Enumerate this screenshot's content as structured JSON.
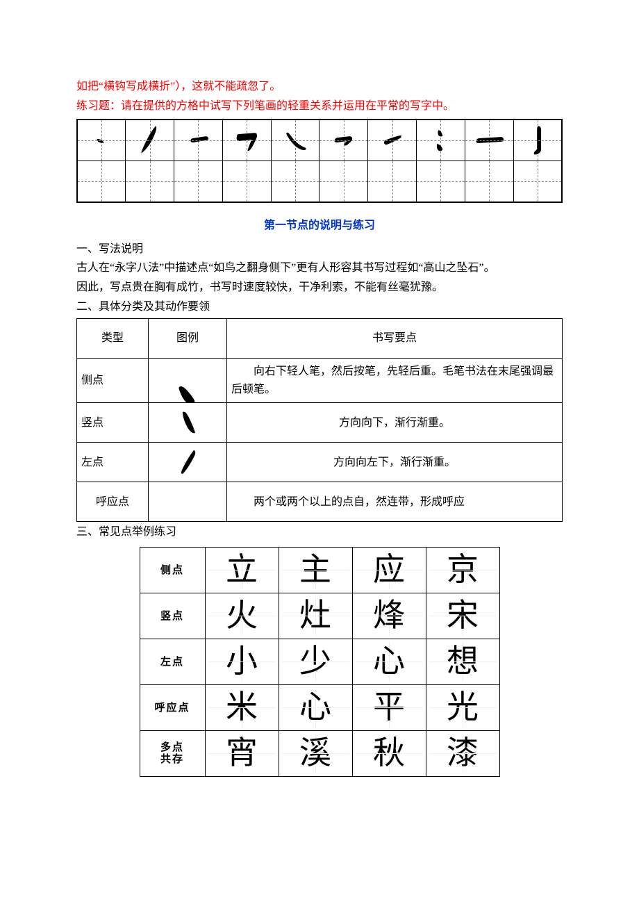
{
  "intro_lines": [
    "如把“横钩写成横折”），这就不能疏忽了。",
    "练习题：请在提供的方格中试写下列笔画的轻重关系并运用在平常的写字中。"
  ],
  "section_title": "第一节点的说明与练习",
  "heading_1": "一、写法说明",
  "body_1a": "古人在“永字八法”中描述点“如鸟之翻身侧下”更有人形容其书写过程如“高山之坠石”。",
  "body_1b": "因此，写点贵在胸有成竹，书写时速度较快，干净利索，不能有丝毫犹豫。",
  "heading_2": "二、具体分类及其动作要领",
  "spec": {
    "h_type": "类型",
    "h_glyph": "图例",
    "h_desc": "书写要点",
    "rows": [
      {
        "type": "侧点",
        "desc": "　　向右下轻人笔，然后按笔，先轻后重。毛笔书法在末尾强调最后顿笔。"
      },
      {
        "type": "竖点",
        "desc": "方向向下，渐行渐重。"
      },
      {
        "type": "左点",
        "desc": "方向向左下，渐行渐重。"
      },
      {
        "type": "呼应点",
        "desc": "　　两个或两个以上的点自，然连带，形成呼应"
      }
    ]
  },
  "heading_3": "三、常见点举例练习",
  "examples": {
    "rows": [
      {
        "label": "侧点",
        "chars": [
          "立",
          "主",
          "应",
          "京"
        ]
      },
      {
        "label": "竖点",
        "chars": [
          "火",
          "灶",
          "烽",
          "宋"
        ]
      },
      {
        "label": "左点",
        "chars": [
          "小",
          "少",
          "心",
          "想"
        ]
      },
      {
        "label": "呼应点",
        "chars": [
          "米",
          "心",
          "平",
          "光"
        ]
      },
      {
        "label": "多点共存",
        "chars": [
          "宵",
          "溪",
          "秋",
          "漆"
        ]
      }
    ]
  }
}
